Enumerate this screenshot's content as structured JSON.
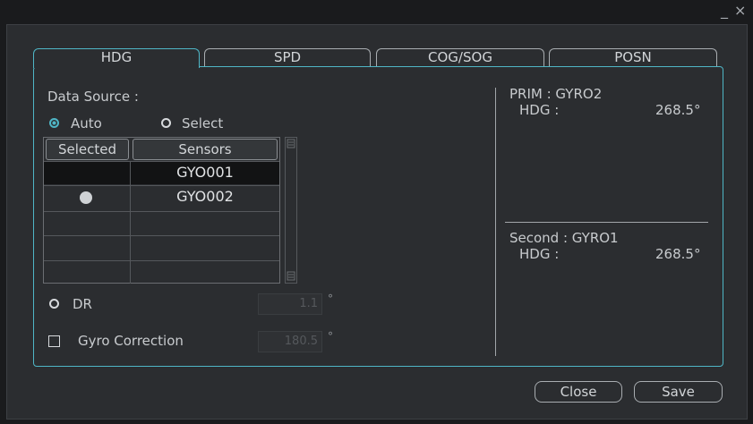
{
  "window": {
    "minimize_glyph": "_",
    "close_glyph": "×"
  },
  "tabs": [
    {
      "label": "HDG",
      "active": true
    },
    {
      "label": "SPD",
      "active": false
    },
    {
      "label": "COG/SOG",
      "active": false
    },
    {
      "label": "POSN",
      "active": false
    }
  ],
  "data_source": {
    "label": "Data Source :",
    "auto_label": "Auto",
    "select_label": "Select",
    "selected": "Auto"
  },
  "sensor_table": {
    "headers": [
      "Selected",
      "Sensors"
    ],
    "rows": [
      {
        "selected": false,
        "sensor": "GYO001"
      },
      {
        "selected": true,
        "sensor": "GYO002"
      },
      {
        "selected": false,
        "sensor": ""
      },
      {
        "selected": false,
        "sensor": ""
      },
      {
        "selected": false,
        "sensor": ""
      }
    ]
  },
  "dr": {
    "label": "DR",
    "value": "1.1",
    "unit": "°"
  },
  "gyro_correction": {
    "label": "Gyro Correction",
    "value": "180.5",
    "unit": "°",
    "checked": false
  },
  "primary": {
    "label": "PRIM : GYRO2",
    "hdg_label": "HDG :",
    "hdg_value": "268.5°"
  },
  "secondary": {
    "label": "Second :  GYRO1",
    "hdg_label": "HDG :",
    "hdg_value": "268.5°"
  },
  "buttons": {
    "close": "Close",
    "save": "Save"
  },
  "colors": {
    "accent": "#4fb6c6",
    "background": "#2b2d30"
  }
}
